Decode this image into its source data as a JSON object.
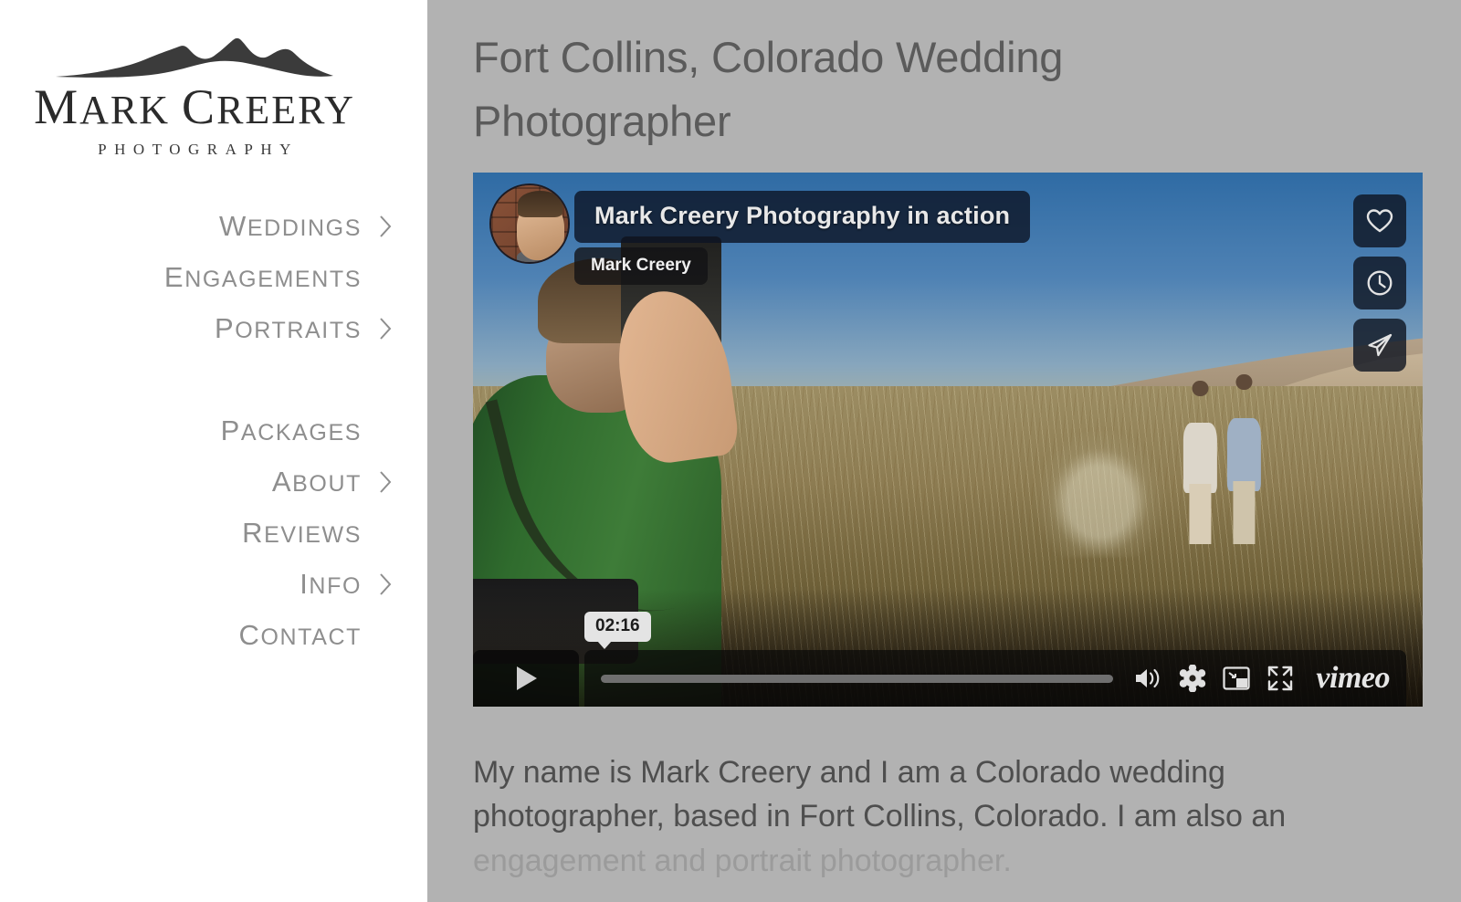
{
  "brand": {
    "name_part1": "M",
    "name_rest1": "ARK",
    "name_part2": "C",
    "name_rest2": "REERY",
    "name_full": "MARK CREERY",
    "tagline": "PHOTOGRAPHY",
    "logo_icon": "mountain-range-icon"
  },
  "sidebar": {
    "nav_groups": [
      {
        "items": [
          {
            "label": "Weddings",
            "cap": "W",
            "rest": "EDDINGS",
            "has_chevron": true,
            "icon": "chevron-right-icon"
          },
          {
            "label": "Engagements",
            "cap": "E",
            "rest": "NGAGEMENTS",
            "has_chevron": false,
            "icon": ""
          },
          {
            "label": "Portraits",
            "cap": "P",
            "rest": "ORTRAITS",
            "has_chevron": true,
            "icon": "chevron-right-icon"
          }
        ]
      },
      {
        "items": [
          {
            "label": "Packages",
            "cap": "P",
            "rest": "ACKAGES",
            "has_chevron": false,
            "icon": ""
          },
          {
            "label": "About",
            "cap": "A",
            "rest": "BOUT",
            "has_chevron": true,
            "icon": "chevron-right-icon"
          },
          {
            "label": "Reviews",
            "cap": "R",
            "rest": "EVIEWS",
            "has_chevron": false,
            "icon": ""
          },
          {
            "label": "Info",
            "cap": "I",
            "rest": "NFO",
            "has_chevron": true,
            "icon": "chevron-right-icon"
          },
          {
            "label": "Contact",
            "cap": "C",
            "rest": "ONTACT",
            "has_chevron": false,
            "icon": ""
          }
        ]
      }
    ]
  },
  "main": {
    "page_title": "Fort Collins, Colorado Wedding Photographer",
    "intro_line1": "My name is Mark Creery and I am a Colorado wedding",
    "intro_line2": "photographer, based in Fort Collins, Colorado. I am also an",
    "intro_line3": "engagement and portrait photographer."
  },
  "video": {
    "title": "Mark Creery Photography in action",
    "author": "Mark Creery",
    "duration": "02:16",
    "provider": "vimeo",
    "avatar_icon": "user-avatar",
    "play_icon": "play-icon",
    "side_buttons": [
      {
        "name": "like-button",
        "icon": "heart-icon"
      },
      {
        "name": "watch-later-button",
        "icon": "clock-icon"
      },
      {
        "name": "share-button",
        "icon": "paper-plane-icon"
      }
    ],
    "controls": [
      {
        "name": "volume-button",
        "icon": "volume-icon"
      },
      {
        "name": "settings-button",
        "icon": "gear-icon"
      },
      {
        "name": "pip-button",
        "icon": "picture-in-picture-icon"
      },
      {
        "name": "fullscreen-button",
        "icon": "fullscreen-icon"
      }
    ]
  },
  "colors": {
    "sidebar_bg": "#ffffff",
    "content_bg": "#b2b2b2",
    "heading_text": "#5b5b5b",
    "nav_text": "#8e8e8e",
    "body_text": "#4e4e4e",
    "body_text_faded": "#9b9b9b",
    "logo_text": "#2b2b2b",
    "overlay_pill": "#0c1424"
  }
}
